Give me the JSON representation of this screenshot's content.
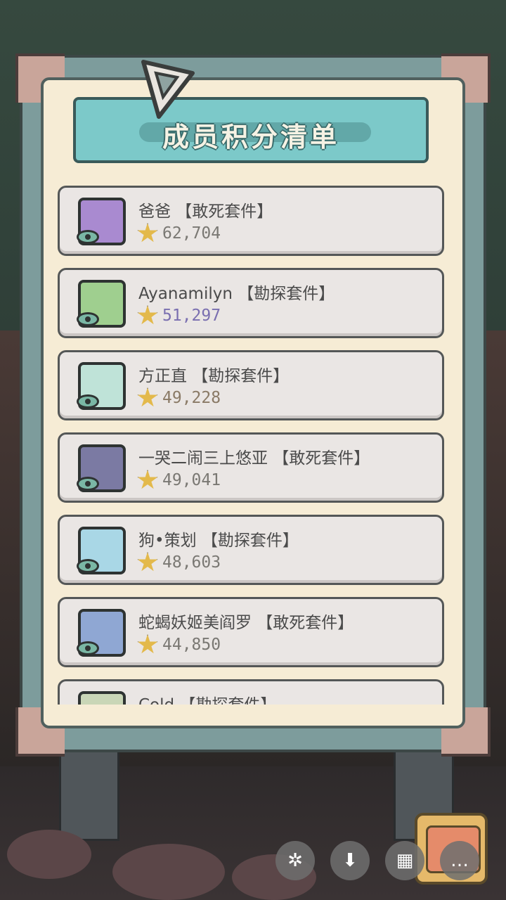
{
  "panel": {
    "title": "成员积分清单"
  },
  "members": [
    {
      "name": "爸爸 【敢死套件】",
      "score": "62,704",
      "avatar_color": "#a98ad0"
    },
    {
      "name": "Ayanamilyn 【勘探套件】",
      "score": "51,297",
      "avatar_color": "#9fcf8f"
    },
    {
      "name": "方正直 【勘探套件】",
      "score": "49,228",
      "avatar_color": "#bfe3d8"
    },
    {
      "name": "一哭二闹三上悠亚 【敢死套件】",
      "score": "49,041",
      "avatar_color": "#7b7aa3"
    },
    {
      "name": "狗•策划 【勘探套件】",
      "score": "48,603",
      "avatar_color": "#a9d7e6"
    },
    {
      "name": "蛇蝎妖姬美阎罗 【敢死套件】",
      "score": "44,850",
      "avatar_color": "#8fa7d3"
    },
    {
      "name": "Cold 【勘探套件】",
      "score": "",
      "avatar_color": "#c9d6b7"
    }
  ],
  "score_colors": [
    "#7a7873",
    "#7a6fb0",
    "#8a7a66",
    "#7a7873",
    "#7a7873",
    "#7a7873",
    "#7a7873"
  ],
  "controls": {
    "sparkle_icon": "✲",
    "download_icon": "⬇",
    "grid_icon": "▦",
    "more_icon": "…"
  }
}
